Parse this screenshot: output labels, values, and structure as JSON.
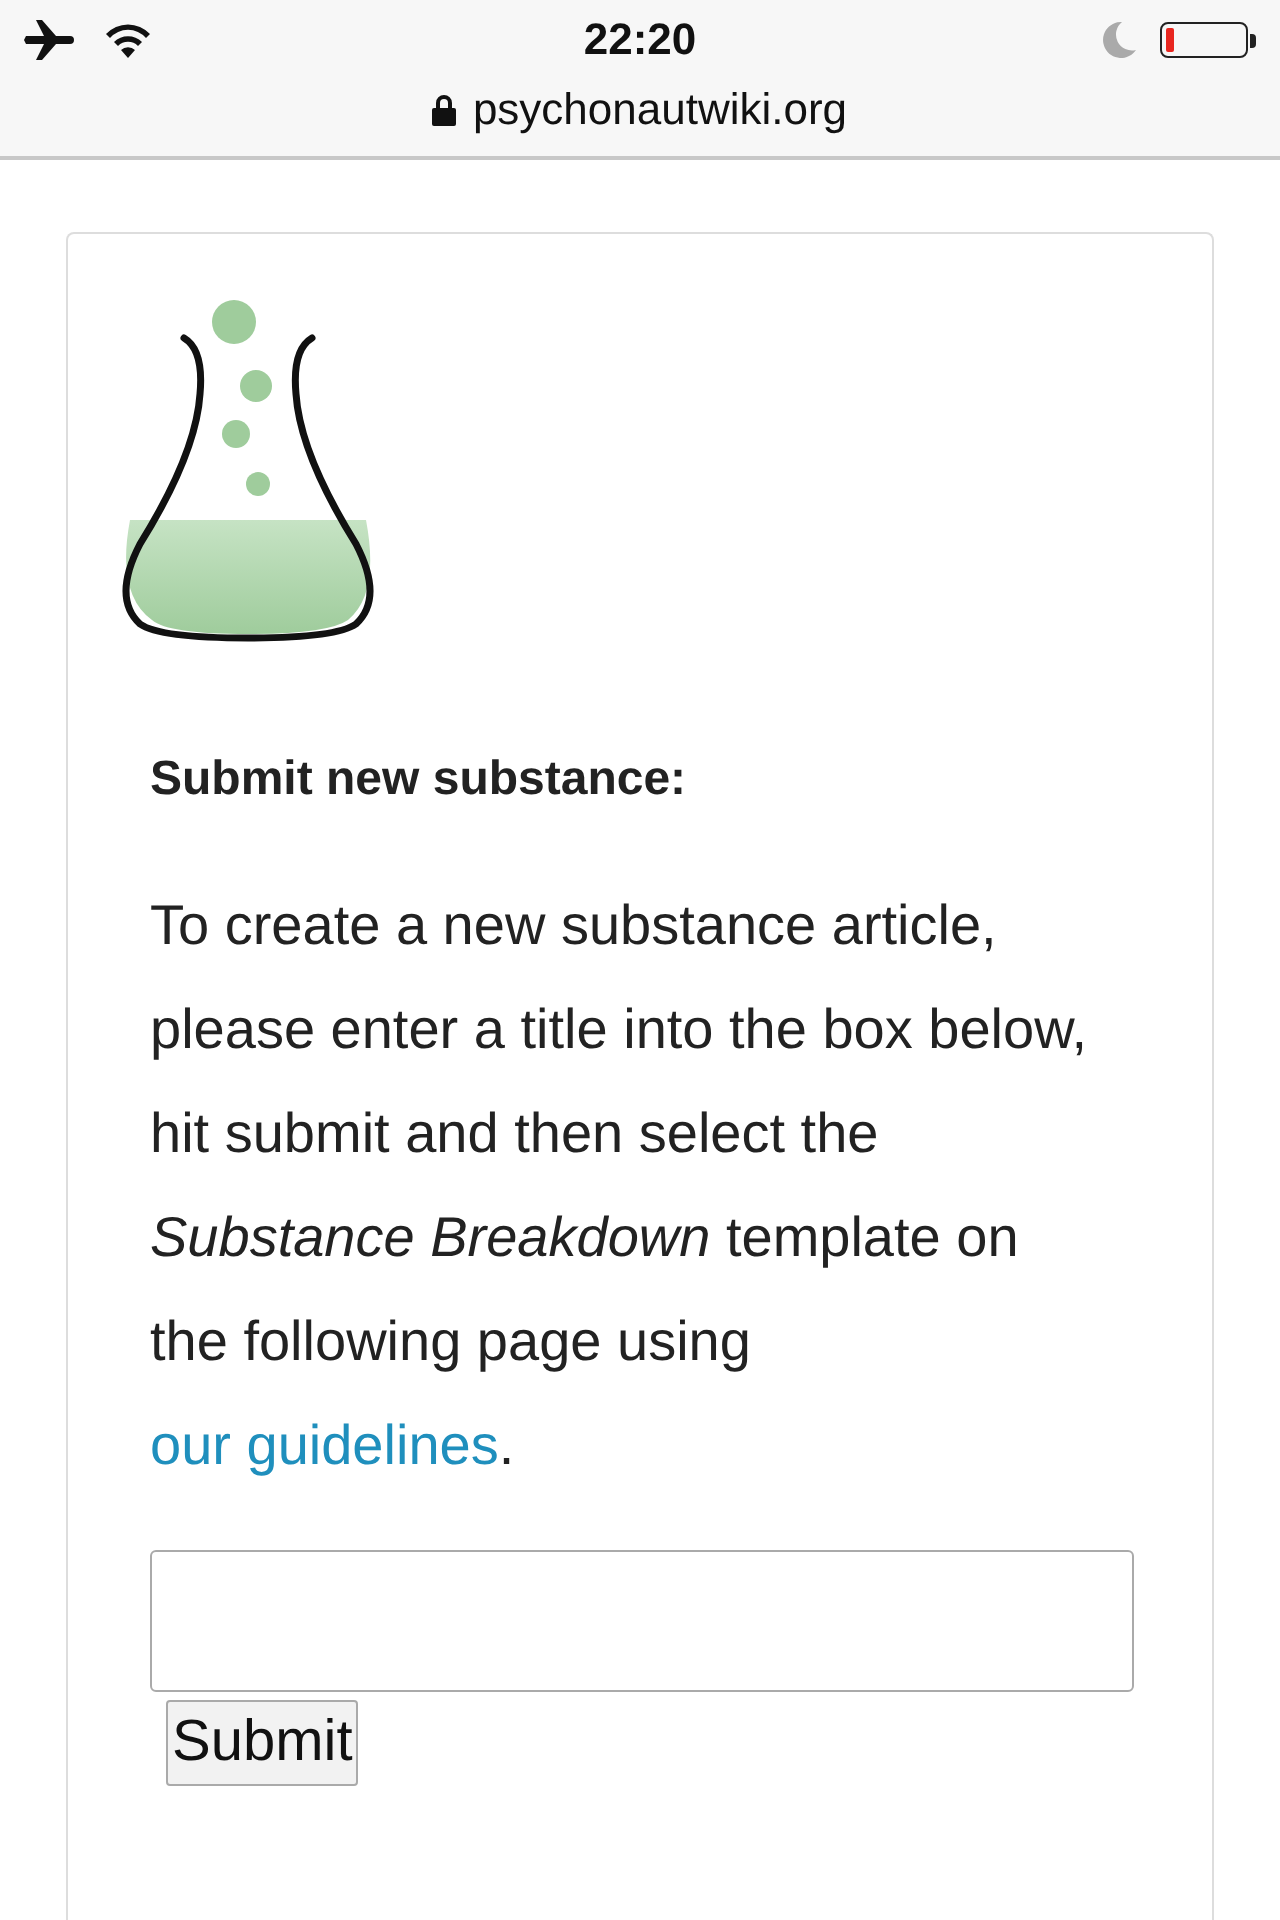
{
  "status_bar": {
    "time": "22:20"
  },
  "address_bar": {
    "url": "psychonautwiki.org"
  },
  "card": {
    "heading": "Submit new substance:",
    "paragraph": {
      "text_before": "To create a new substance article, please enter a title into the box below, hit submit and then select the *Substance Breakdown* template on the following page using ",
      "link": "our guidelines",
      "text_after": "."
    },
    "submit_button": "Submit"
  }
}
